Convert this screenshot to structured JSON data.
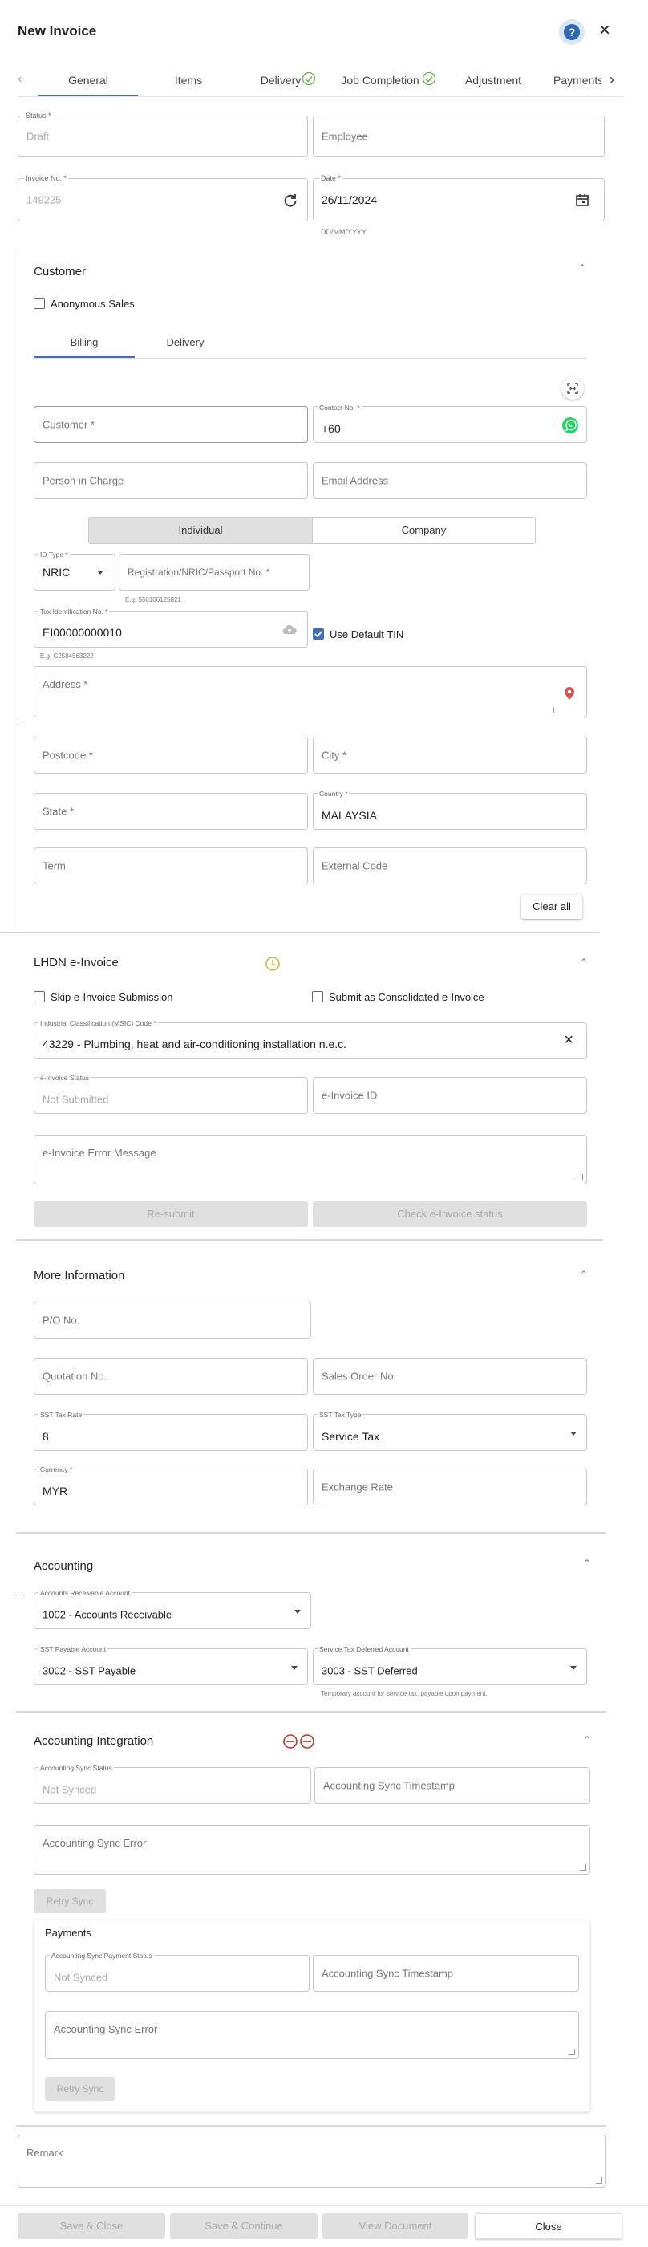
{
  "header": {
    "title": "New Invoice"
  },
  "tabs": [
    "General",
    "Items",
    "Delivery",
    "Job Completion",
    "Adjustment",
    "Payments"
  ],
  "general": {
    "status_label": "Status",
    "status_value": "Draft",
    "employee_placeholder": "Employee",
    "invoice_no_label": "Invoice No.",
    "invoice_no_value": "149225",
    "date_label": "Date",
    "date_value": "26/11/2024",
    "date_hint": "DD/MM/YYYY"
  },
  "customer": {
    "section_title": "Customer",
    "anonymous_sales_label": "Anonymous Sales",
    "subtabs": [
      "Billing",
      "Delivery"
    ],
    "customer_placeholder": "Customer *",
    "contact_label": "Contact No.",
    "contact_value": "+60",
    "person_in_charge_placeholder": "Person in Charge",
    "email_placeholder": "Email Address",
    "type_options": [
      "Individual",
      "Company"
    ],
    "id_type_label": "ID Type",
    "id_type_value": "NRIC",
    "registration_placeholder": "Registration/NRIC/Passport No. *",
    "registration_hint": "E.g. 550106125821",
    "tin_label": "Tax Identification No.",
    "tin_value": "EI00000000010",
    "tin_hint": "E.g. C2584563222",
    "use_default_tin_label": "Use Default TIN",
    "address_placeholder": "Address *",
    "postcode_placeholder": "Postcode *",
    "city_placeholder": "City *",
    "state_placeholder": "State *",
    "country_label": "Country",
    "country_value": "MALAYSIA",
    "term_placeholder": "Term",
    "external_code_placeholder": "External Code",
    "clear_all_label": "Clear all"
  },
  "einvoice": {
    "section_title": "LHDN e-Invoice",
    "skip_label": "Skip e-Invoice Submission",
    "consolidated_label": "Submit as Consolidated e-Invoice",
    "msic_label": "Industrial Classification (MSIC) Code",
    "msic_value": "43229 - Plumbing, heat and air-conditioning installation n.e.c.",
    "status_label": "e-Invoice Status",
    "status_value": "Not Submitted",
    "id_placeholder": "e-Invoice ID",
    "error_placeholder": "e-Invoice Error Message",
    "resubmit_label": "Re-submit",
    "check_status_label": "Check e-Invoice status"
  },
  "more_info": {
    "section_title": "More Information",
    "po_placeholder": "P/O No.",
    "quotation_placeholder": "Quotation No.",
    "sales_order_placeholder": "Sales Order No.",
    "sst_rate_label": "SST Tax Rate",
    "sst_rate_value": "8",
    "sst_type_label": "SST Tax Type",
    "sst_type_value": "Service Tax",
    "currency_label": "Currency",
    "currency_value": "MYR",
    "exchange_rate_placeholder": "Exchange Rate"
  },
  "accounting": {
    "section_title": "Accounting",
    "ar_label": "Accounts Receivable Account",
    "ar_value": "1002 - Accounts Receivable",
    "sst_payable_label": "SST Payable Account",
    "sst_payable_value": "3002 - SST Payable",
    "sst_deferred_label": "Service Tax Deferred Account",
    "sst_deferred_value": "3003 - SST Deferred",
    "sst_deferred_hint": "Temporary account for service tax, payable upon payment."
  },
  "integration": {
    "section_title": "Accounting Integration",
    "sync_status_label": "Accounting Sync Status",
    "sync_status_value": "Not Synced",
    "sync_timestamp_placeholder": "Accounting Sync Timestamp",
    "sync_error_placeholder": "Accounting Sync Error",
    "retry_label": "Retry Sync",
    "payments_title": "Payments",
    "pay_sync_status_label": "Accounting Sync Payment Status",
    "pay_sync_status_value": "Not Synced",
    "pay_sync_timestamp_placeholder": "Accounting Sync Timestamp",
    "pay_sync_error_placeholder": "Accounting Sync Error",
    "pay_retry_label": "Retry Sync"
  },
  "footer": {
    "remark_placeholder": "Remark",
    "save_close_label": "Save & Close",
    "save_continue_label": "Save & Continue",
    "view_document_label": "View Document",
    "close_label": "Close"
  },
  "colors": {
    "accent": "#3f6fb6",
    "whatsapp": "#25d366",
    "pending": "#e0b23a",
    "error": "#c0392b",
    "location": "#d9534f"
  }
}
